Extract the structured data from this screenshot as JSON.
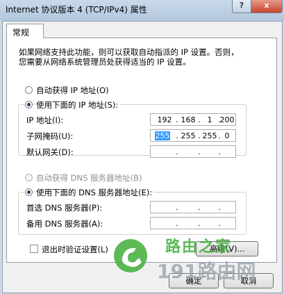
{
  "window": {
    "title": "Internet 协议版本 4 (TCP/IPv4) 属性",
    "help_label": "?",
    "close_label": "x"
  },
  "tab": {
    "label": "常规"
  },
  "description": [
    "如果网络支持此功能，则可以获取自动指派的 IP 设置。否则，",
    "您需要从网络系统管理员处获得适当的 IP 设置。"
  ],
  "ip_section": {
    "auto_label": "自动获得 IP 地址(O)",
    "manual_label": "使用下面的 IP 地址(S):",
    "selected": "manual",
    "fields": [
      {
        "label": "IP 地址(I):",
        "segments": [
          "192",
          "168",
          "1",
          "200"
        ]
      },
      {
        "label": "子网掩码(U):",
        "segments": [
          "255",
          "255",
          "255",
          "0"
        ]
      },
      {
        "label": "默认网关(D):",
        "segments": [
          "",
          "",
          "",
          ""
        ]
      }
    ]
  },
  "dns_section": {
    "auto_label": "自动获得 DNS 服务器地址(B)",
    "manual_label": "使用下面的 DNS 服务器地址(E):",
    "selected": "manual",
    "fields": [
      {
        "label": "首选 DNS 服务器(P):",
        "segments": [
          "",
          "",
          "",
          ""
        ]
      },
      {
        "label": "备用 DNS 服务器(A):",
        "segments": [
          "",
          "",
          "",
          ""
        ]
      }
    ]
  },
  "validate_checkbox": {
    "label": "退出时验证设置(L)",
    "checked": false
  },
  "buttons": {
    "advanced": "高级(V)...",
    "ok": "确定",
    "cancel": "取消"
  },
  "watermark": {
    "line1": "路由之家",
    "line2": "191路由网"
  },
  "colors": {
    "selection": "#3399ff",
    "watermark_green": "#3fae3a"
  }
}
